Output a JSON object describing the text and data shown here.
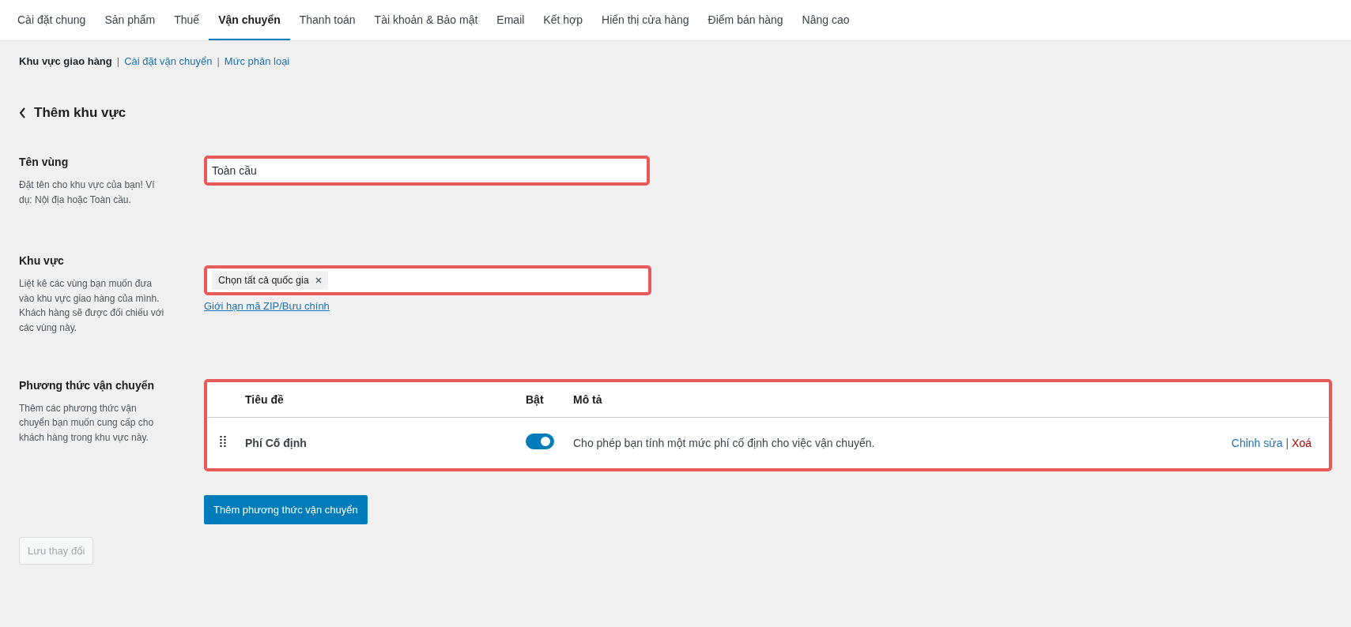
{
  "tabs": [
    {
      "label": "Cài đặt chung",
      "selected": false
    },
    {
      "label": "Sản phẩm",
      "selected": false
    },
    {
      "label": "Thuế",
      "selected": false
    },
    {
      "label": "Vận chuyển",
      "selected": true
    },
    {
      "label": "Thanh toán",
      "selected": false
    },
    {
      "label": "Tài khoản & Bảo mật",
      "selected": false
    },
    {
      "label": "Email",
      "selected": false
    },
    {
      "label": "Kết hợp",
      "selected": false
    },
    {
      "label": "Hiển thị cửa hàng",
      "selected": false
    },
    {
      "label": "Điểm bán hàng",
      "selected": false
    },
    {
      "label": "Nâng cao",
      "selected": false
    }
  ],
  "subnav_separator": "|",
  "subnav": [
    {
      "label": "Khu vực giao hàng",
      "selected": true
    },
    {
      "label": "Cài đặt vận chuyển",
      "selected": false
    },
    {
      "label": "Mức phân loại",
      "selected": false
    }
  ],
  "heading": "Thêm khu vực",
  "zone_name": {
    "label": "Tên vùng",
    "description": "Đặt tên cho khu vực của bạn! Ví dụ: Nội địa hoặc Toàn cầu.",
    "value": "Toàn cầu",
    "highlighted": true
  },
  "regions": {
    "label": "Khu vực",
    "description": "Liệt kê các vùng bạn muốn đưa vào khu vực giao hàng của mình. Khách hàng sẽ được đối chiếu với các vùng này.",
    "tokens": [
      "Chọn tất cả quốc gia"
    ],
    "link": "Giới hạn mã ZIP/Bưu chính",
    "highlighted": true
  },
  "methods": {
    "label": "Phương thức vận chuyển",
    "description": "Thêm các phương thức vận chuyển bạn muốn cung cấp cho khách hàng trong khu vực này.",
    "highlighted": true,
    "columns": [
      "Tiêu đề",
      "Bật",
      "Mô tả"
    ],
    "rows": [
      {
        "title": "Phí Cố định",
        "on": true,
        "description": "Cho phép bạn tính một mức phí cố định cho việc vận chuyển.",
        "edit": "Chỉnh sửa",
        "separator": "|",
        "delete": "Xoá"
      }
    ],
    "add_button": "Thêm phương thức vận chuyển"
  },
  "save_button": {
    "label": "Lưu thay đổi",
    "disabled": true
  }
}
